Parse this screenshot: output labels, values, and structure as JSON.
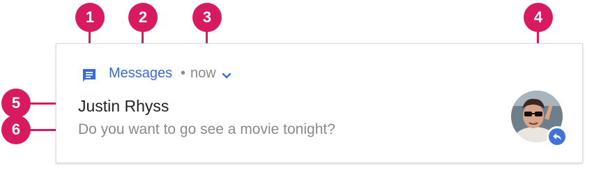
{
  "notification": {
    "app_icon": "messages-icon",
    "app_name": "Messages",
    "separator": "•",
    "time": "now",
    "expand_icon": "chevron-down-icon",
    "title": "Justin Rhyss",
    "text": "Do you want to go see a movie tonight?",
    "avatar": "contact-photo",
    "reply_icon": "reply-icon"
  },
  "callouts": [
    "1",
    "2",
    "3",
    "4",
    "5",
    "6"
  ],
  "colors": {
    "callout": "#d81b60",
    "accent": "#3b6bd6",
    "secondary_text": "#8a8a8a"
  }
}
